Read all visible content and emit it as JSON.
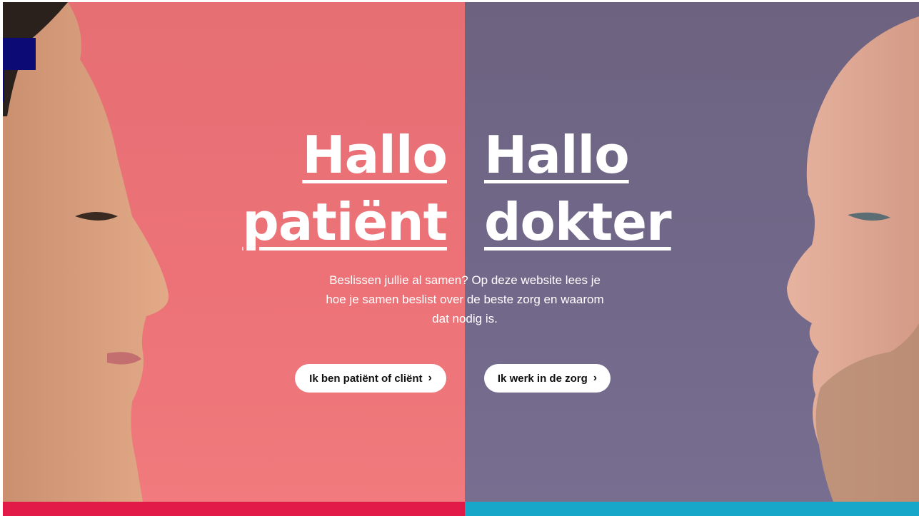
{
  "hero": {
    "patient": {
      "line1": "Hallo",
      "line2": "patiënt"
    },
    "doctor": {
      "line1": "Hallo",
      "line2": "dokter"
    },
    "intro": "Beslissen jullie al samen? Op deze website lees je hoe je samen beslist over de beste zorg en waarom dat nodig is.",
    "patient_button": "Ik ben patiënt of cliënt",
    "doctor_button": "Ik werk in de zorg",
    "chevron": "›"
  },
  "colors": {
    "patient_panel": "#ec7277",
    "doctor_panel": "#6f6685",
    "patient_bar": "#e11a47",
    "doctor_bar": "#17a8c9",
    "logo": "#0c0a74"
  },
  "icons": {
    "button_arrow": "chevron-right-icon"
  }
}
